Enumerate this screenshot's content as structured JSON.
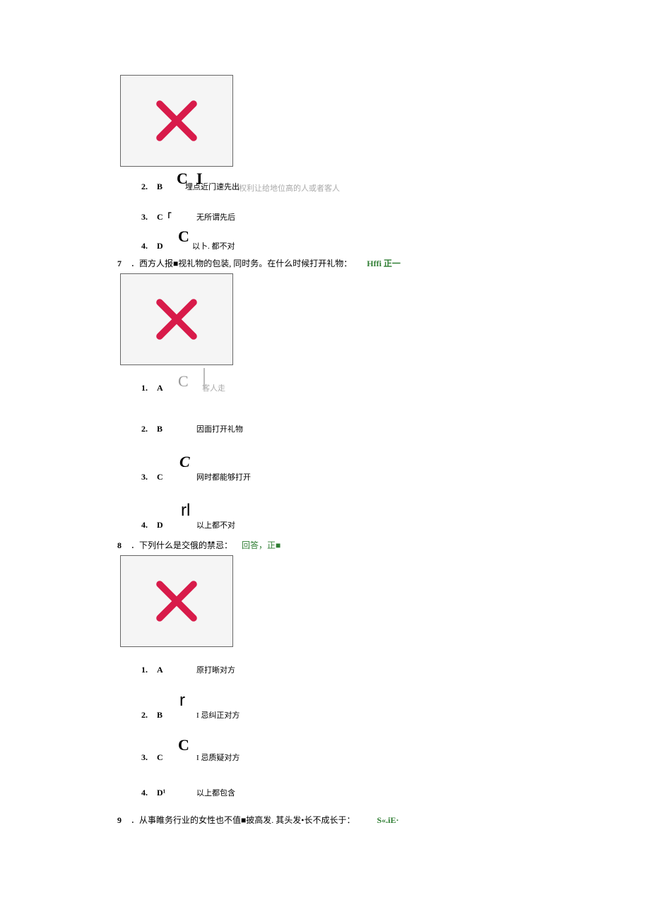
{
  "q6_partial": {
    "opt2": {
      "n": "2.",
      "letter": "B",
      "glyph1": "C",
      "glyph2": "I",
      "text": "埋点近门速先出",
      "faded": "权利让给地位高的人或者客人"
    },
    "opt1watermark": "",
    "opt3": {
      "n": "3.",
      "letter": "C「",
      "text": "无所谓先后"
    },
    "opt4": {
      "n": "4.",
      "letter": "D",
      "glyph": "C",
      "text": "以卜. 都不对"
    }
  },
  "q7": {
    "num": "7",
    "stem": "．西方人报■视礼物的包装, 同时务。在什么时候打开礼物：",
    "green": "Hffi 正一",
    "opt1": {
      "n": "1.",
      "letter": "A",
      "glyph": "C",
      "text": "客人走"
    },
    "opt2": {
      "n": "2.",
      "letter": "B",
      "text": "因面打开礼物"
    },
    "opt3": {
      "n": "3.",
      "letter": "C",
      "glyph": "C",
      "text": "网时都能够打开"
    },
    "opt4": {
      "n": "4.",
      "letter": "D",
      "glyph": "rl",
      "text": "以上都不对"
    }
  },
  "q8": {
    "num": "8",
    "stem": "．下列什么是交俄的禁忌：",
    "green": "回答，正■",
    "opt1": {
      "n": "1.",
      "letter": "A",
      "text": "原打晰对方"
    },
    "opt2": {
      "n": "2.",
      "letter": "B",
      "glyph": "r",
      "text": "I 忌纠正对方"
    },
    "opt3": {
      "n": "3.",
      "letter": "C",
      "glyph": "C",
      "text": "I 忌质疑对方"
    },
    "opt4": {
      "n": "4.",
      "letter": "D¹",
      "text": "以上都包含"
    }
  },
  "q9": {
    "num": "9",
    "stem": "．从事睢务行业的女性也不值■披高发. 其头发•长不成长于：",
    "green": "S«.iE·"
  }
}
